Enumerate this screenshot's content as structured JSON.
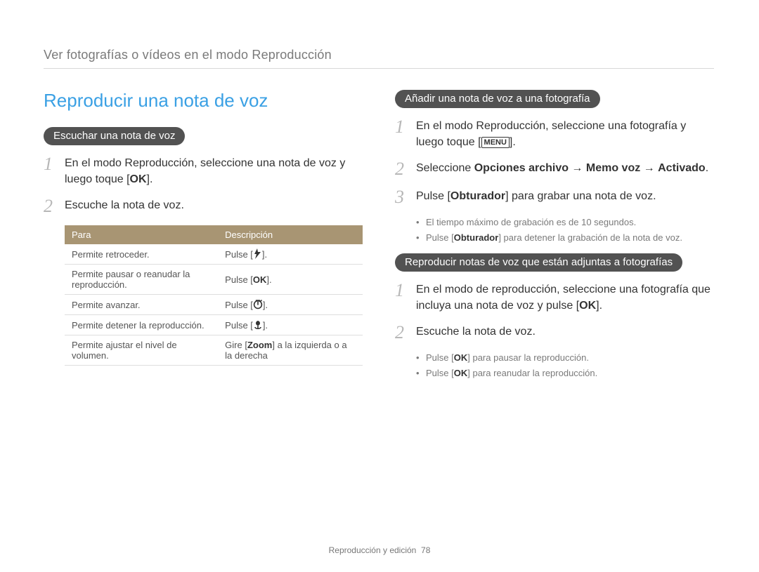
{
  "header": {
    "breadcrumb": "Ver fotografías o vídeos en el modo Reproducción"
  },
  "left": {
    "title": "Reproducir una nota de voz",
    "pill": "Escuchar una nota de voz",
    "step1_before": "En el modo Reproducción, seleccione una nota de voz y luego toque [",
    "step1_after": "].",
    "ok": "OK",
    "step2": "Escuche la nota de voz.",
    "table": {
      "h1": "Para",
      "h2": "Descripción",
      "rows": [
        {
          "l": "Permite retroceder.",
          "r_before": "Pulse [",
          "r_after": "].",
          "icon": "flash"
        },
        {
          "l": "Permite pausar o reanudar la reproducción.",
          "r_before": "Pulse [",
          "r_after": "].",
          "icon": "ok"
        },
        {
          "l": "Permite avanzar.",
          "r_before": "Pulse [",
          "r_after": "].",
          "icon": "timer"
        },
        {
          "l": "Permite detener la reproducción.",
          "r_before": "Pulse [",
          "r_after": "].",
          "icon": "macro"
        },
        {
          "l": "Permite ajustar el nivel de volumen.",
          "r_plain_before": "Gire [",
          "r_bold": "Zoom",
          "r_plain_after": "] a la izquierda o a la derecha"
        }
      ]
    }
  },
  "right": {
    "pill1": "Añadir una nota de voz a una fotografía",
    "s1_before": "En el modo Reproducción, seleccione una fotografía y luego toque [",
    "menu": "MENU",
    "s1_after": "].",
    "s2_before": "Seleccione ",
    "s2_bold1": "Opciones archivo",
    "s2_arrow": " → ",
    "s2_bold2": "Memo voz",
    "s2_bold3": "Activado",
    "s2_period": ".",
    "s3_before": "Pulse [",
    "s3_bold": "Obturador",
    "s3_after": "] para grabar una nota de voz.",
    "s3_sub": [
      "El tiempo máximo de grabación es de 10 segundos.",
      {
        "before": "Pulse [",
        "bold": "Obturador",
        "after": "] para detener la grabación de la nota de voz."
      }
    ],
    "pill2": "Reproducir notas de voz que están adjuntas a fotografías",
    "p1_before": "En el modo de reproducción, seleccione una fotografía que incluya una nota de voz y pulse [",
    "p1_after": "].",
    "p2": "Escuche la nota de voz.",
    "p2_sub": [
      {
        "before": "Pulse [",
        "after": "] para pausar la reproducción."
      },
      {
        "before": "Pulse [",
        "after": "] para reanudar la reproducción."
      }
    ]
  },
  "footer": {
    "label": "Reproducción y edición",
    "page": "78"
  },
  "numbers": {
    "n1": "1",
    "n2": "2",
    "n3": "3"
  }
}
